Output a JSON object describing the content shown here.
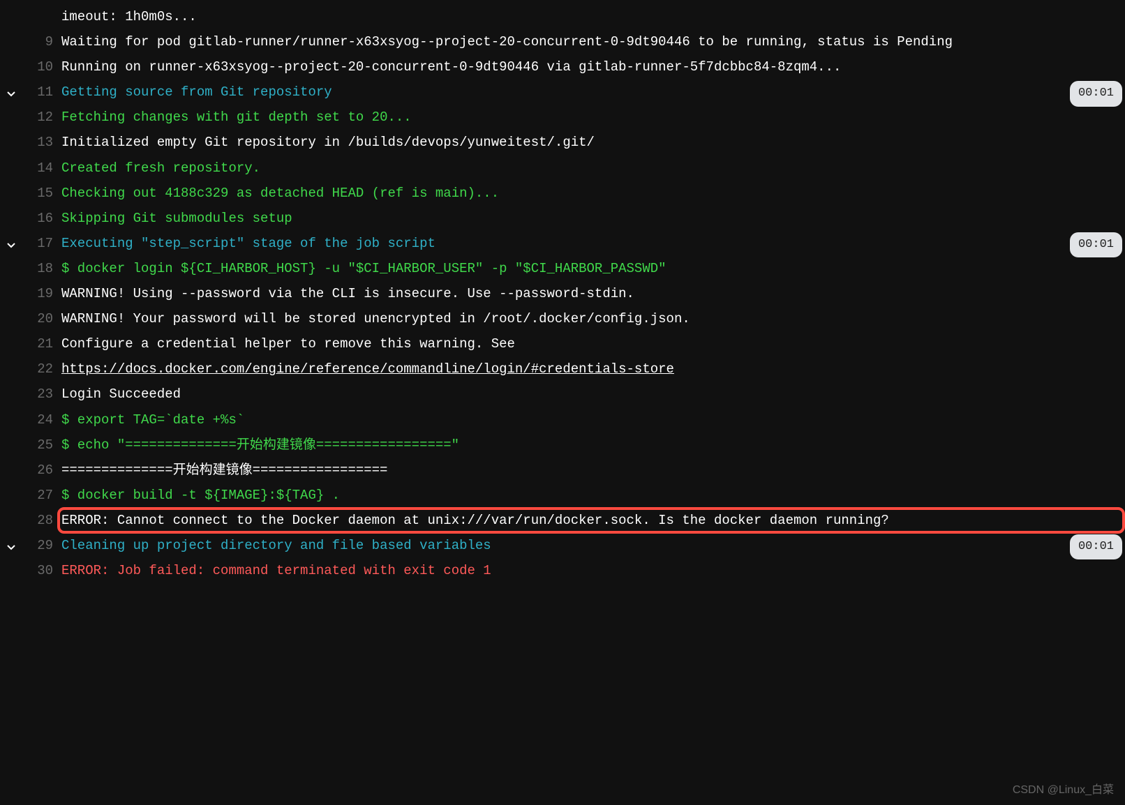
{
  "badges": {
    "d1": "00:01",
    "d2": "00:01",
    "d3": "00:01"
  },
  "watermark": "CSDN @Linux_白菜",
  "lines": {
    "l8": {
      "num": "",
      "text": "imeout: 1h0m0s...",
      "color": "white"
    },
    "l9": {
      "num": "9",
      "text": "Waiting for pod gitlab-runner/runner-x63xsyog--project-20-concurrent-0-9dt90446 to be running, status is Pending",
      "color": "white"
    },
    "l10": {
      "num": "10",
      "text": "Running on runner-x63xsyog--project-20-concurrent-0-9dt90446 via gitlab-runner-5f7dcbbc84-8zqm4...",
      "color": "white"
    },
    "l11": {
      "num": "11",
      "text": "Getting source from Git repository",
      "color": "cyan"
    },
    "l12": {
      "num": "12",
      "text": "Fetching changes with git depth set to 20...",
      "color": "green"
    },
    "l13": {
      "num": "13",
      "text": "Initialized empty Git repository in /builds/devops/yunweitest/.git/",
      "color": "white"
    },
    "l14": {
      "num": "14",
      "text": "Created fresh repository.",
      "color": "green"
    },
    "l15": {
      "num": "15",
      "text": "Checking out 4188c329 as detached HEAD (ref is main)...",
      "color": "green"
    },
    "l16": {
      "num": "16",
      "text": "Skipping Git submodules setup",
      "color": "green"
    },
    "l17": {
      "num": "17",
      "text": "Executing \"step_script\" stage of the job script",
      "color": "cyan"
    },
    "l18": {
      "num": "18",
      "text": "$ docker login ${CI_HARBOR_HOST} -u \"$CI_HARBOR_USER\" -p \"$CI_HARBOR_PASSWD\"",
      "color": "green"
    },
    "l19": {
      "num": "19",
      "text": "WARNING! Using --password via the CLI is insecure. Use --password-stdin.",
      "color": "white"
    },
    "l20": {
      "num": "20",
      "text": "WARNING! Your password will be stored unencrypted in /root/.docker/config.json.",
      "color": "white"
    },
    "l21": {
      "num": "21",
      "text": "Configure a credential helper to remove this warning. See",
      "color": "white"
    },
    "l22": {
      "num": "22",
      "text": "https://docs.docker.com/engine/reference/commandline/login/#credentials-store",
      "color": "link"
    },
    "l23": {
      "num": "23",
      "text": "Login Succeeded",
      "color": "white"
    },
    "l24": {
      "num": "24",
      "text": "$ export TAG=`date +%s`",
      "color": "green"
    },
    "l25": {
      "num": "25",
      "text": "$ echo \"==============开始构建镜像=================\"",
      "color": "green"
    },
    "l26": {
      "num": "26",
      "text": "==============开始构建镜像=================",
      "color": "white"
    },
    "l27": {
      "num": "27",
      "text": "$ docker build -t ${IMAGE}:${TAG} .",
      "color": "green"
    },
    "l28": {
      "num": "28",
      "text": "ERROR: Cannot connect to the Docker daemon at unix:///var/run/docker.sock. Is the docker daemon running?",
      "color": "white"
    },
    "l29": {
      "num": "29",
      "text": "Cleaning up project directory and file based variables",
      "color": "cyan"
    },
    "l30": {
      "num": "30",
      "text": "ERROR: Job failed: command terminated with exit code 1",
      "color": "red"
    }
  }
}
